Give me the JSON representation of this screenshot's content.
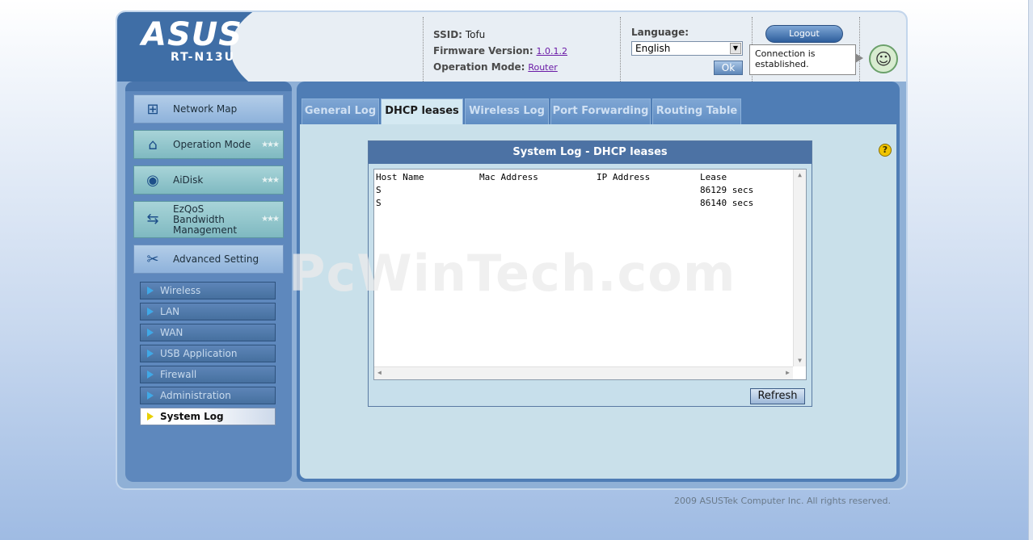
{
  "brand": {
    "logo": "ASUS",
    "model": "RT-N13U"
  },
  "info": {
    "ssid_label": "SSID:",
    "ssid_value": "Tofu",
    "firmware_label": "Firmware Version:",
    "firmware_value": "1.0.1.2",
    "opmode_label": "Operation Mode:",
    "opmode_value": "Router"
  },
  "language": {
    "label": "Language:",
    "selected": "English",
    "ok_label": "Ok"
  },
  "logout_label": "Logout",
  "connection_status": "Connection is established.",
  "sidebar": {
    "main_items": [
      {
        "label": "Network Map",
        "icon": "network-map-icon"
      },
      {
        "label": "Operation Mode",
        "icon": "router-icon"
      },
      {
        "label": "AiDisk",
        "icon": "disk-icon"
      },
      {
        "label": "EzQoS Bandwidth Management",
        "icon": "bandwidth-icon"
      },
      {
        "label": "Advanced Setting",
        "icon": "tools-icon"
      }
    ],
    "sub_items": [
      {
        "label": "Wireless"
      },
      {
        "label": "LAN"
      },
      {
        "label": "WAN"
      },
      {
        "label": "USB Application"
      },
      {
        "label": "Firewall"
      },
      {
        "label": "Administration"
      },
      {
        "label": "System Log"
      }
    ],
    "active_sub": "System Log"
  },
  "tabs": [
    {
      "label": "General Log"
    },
    {
      "label": "DHCP leases"
    },
    {
      "label": "Wireless Log"
    },
    {
      "label": "Port Forwarding"
    },
    {
      "label": "Routing Table"
    }
  ],
  "active_tab": "DHCP leases",
  "panel": {
    "title": "System Log - DHCP leases",
    "headers": [
      "Host Name",
      "Mac Address",
      "IP Address",
      "Lease"
    ],
    "rows": [
      {
        "host": "S",
        "lease": "86129 secs"
      },
      {
        "host": "S",
        "lease": "86140 secs"
      }
    ],
    "refresh_label": "Refresh"
  },
  "watermark": "PcWinTech.com",
  "footer": "2009 ASUSTek Computer Inc. All rights reserved.",
  "colors": {
    "accent": "#4f7db5",
    "header_dark": "#3f6ea6",
    "menu_teal": "#8fc3ca"
  }
}
